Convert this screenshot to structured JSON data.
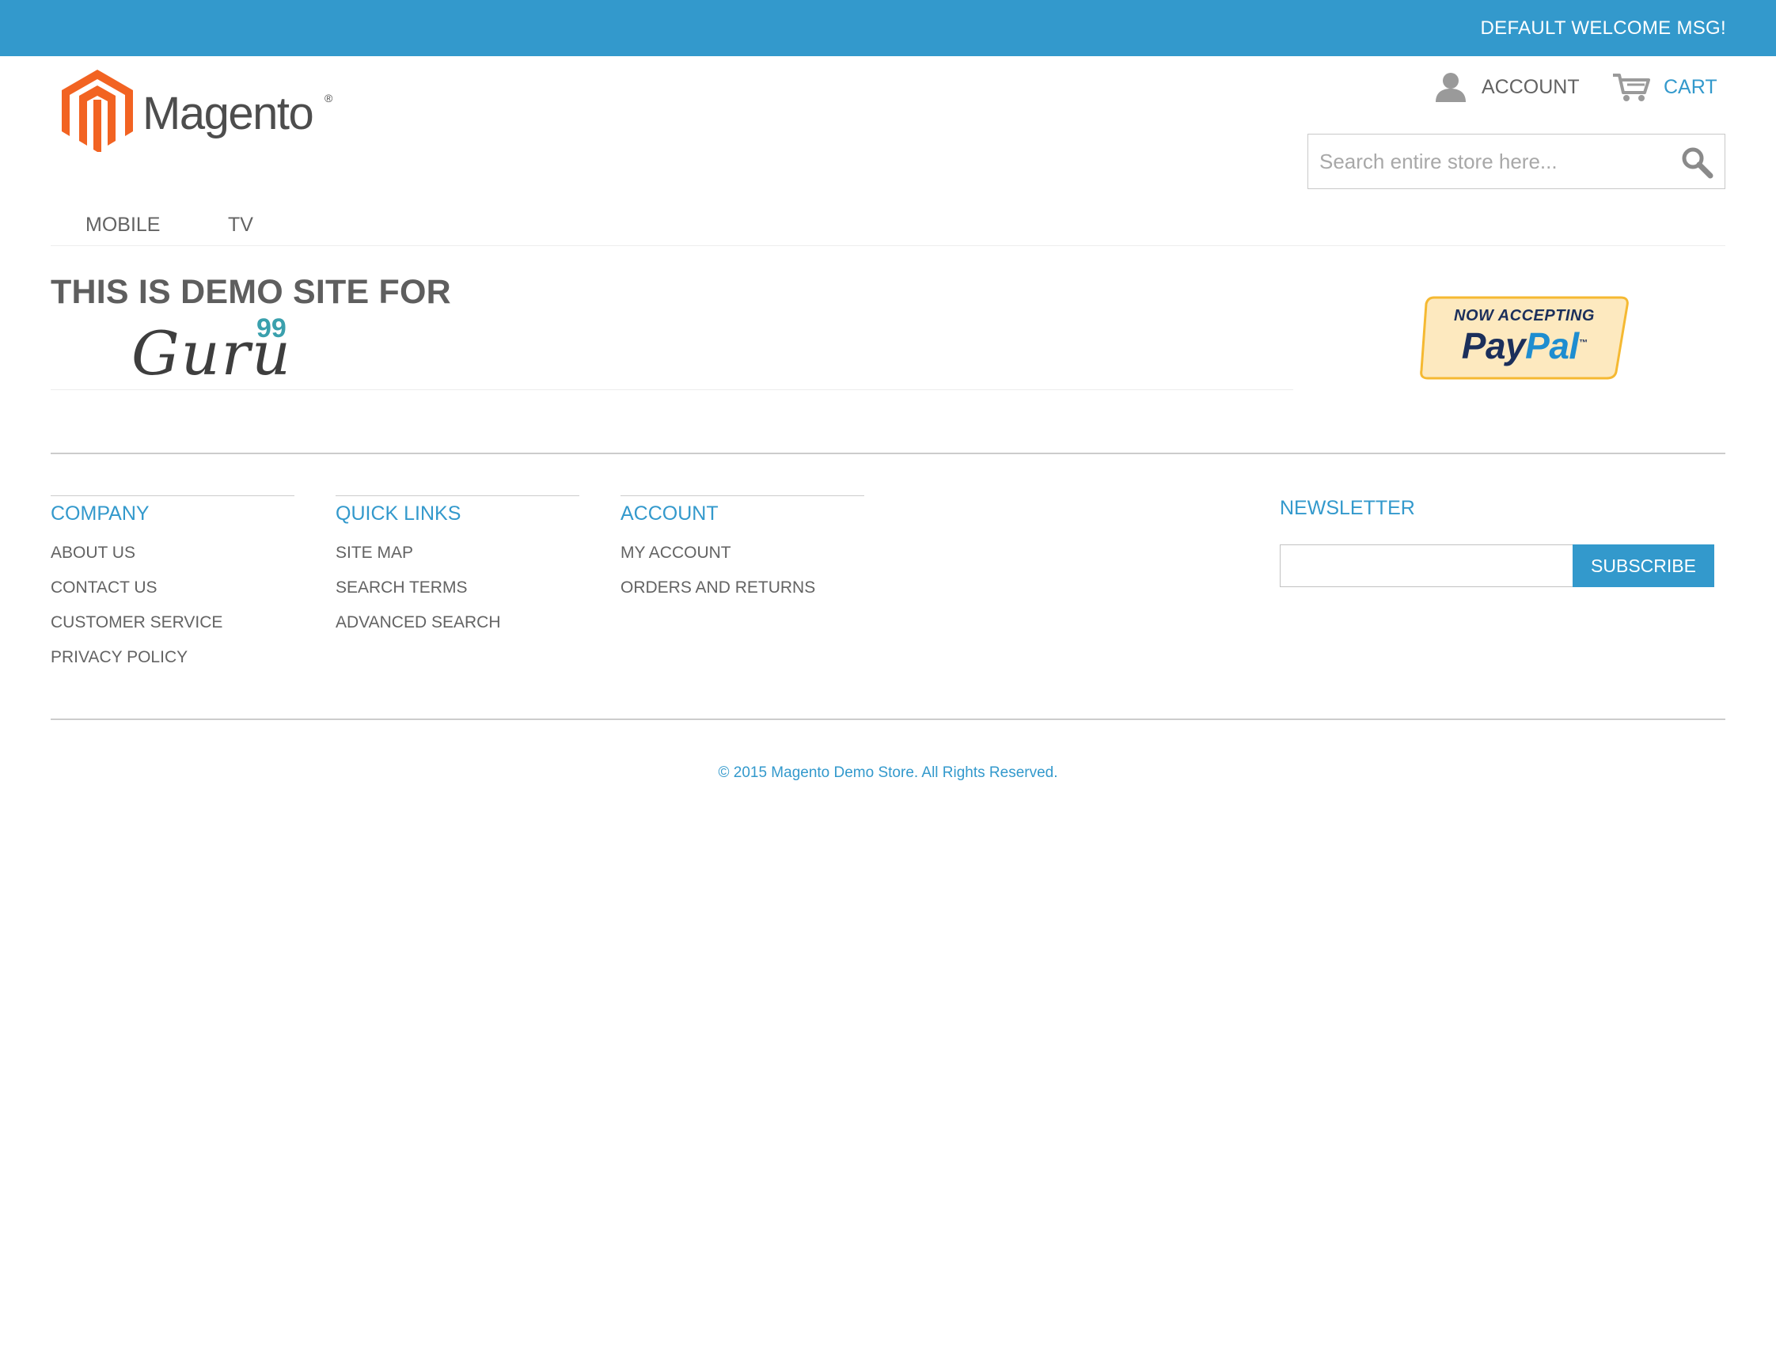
{
  "header": {
    "welcome_msg": "DEFAULT WELCOME MSG!",
    "logo_text": "Magento",
    "logo_reg": "®",
    "account_label": "ACCOUNT",
    "cart_label": "CART",
    "search_placeholder": "Search entire store here..."
  },
  "nav": {
    "items": [
      {
        "label": "MOBILE"
      },
      {
        "label": "TV"
      }
    ]
  },
  "hero": {
    "title": "THIS IS DEMO SITE FOR",
    "brand_word": "Guru",
    "brand_sup": "99",
    "paypal_top": "NOW ACCEPTING",
    "paypal_pay": "Pay",
    "paypal_pal": "Pal",
    "paypal_tm": "™"
  },
  "footer": {
    "columns": [
      {
        "title": "COMPANY",
        "links": [
          "ABOUT US",
          "CONTACT US",
          "CUSTOMER SERVICE",
          "PRIVACY POLICY"
        ]
      },
      {
        "title": "QUICK LINKS",
        "links": [
          "SITE MAP",
          "SEARCH TERMS",
          "ADVANCED SEARCH"
        ]
      },
      {
        "title": "ACCOUNT",
        "links": [
          "MY ACCOUNT",
          "ORDERS AND RETURNS"
        ]
      }
    ],
    "newsletter_title": "NEWSLETTER",
    "newsletter_value": "",
    "subscribe_label": "SUBSCRIBE",
    "copyright": "© 2015 Magento Demo Store. All Rights Reserved."
  },
  "colors": {
    "brand_blue": "#3399cc",
    "logo_orange": "#f26322",
    "text_gray": "#636363",
    "paypal_bg": "#fde9bf",
    "paypal_border": "#f5b932"
  },
  "icons": [
    "magento-logo-icon",
    "user-icon",
    "cart-icon",
    "search-icon"
  ]
}
